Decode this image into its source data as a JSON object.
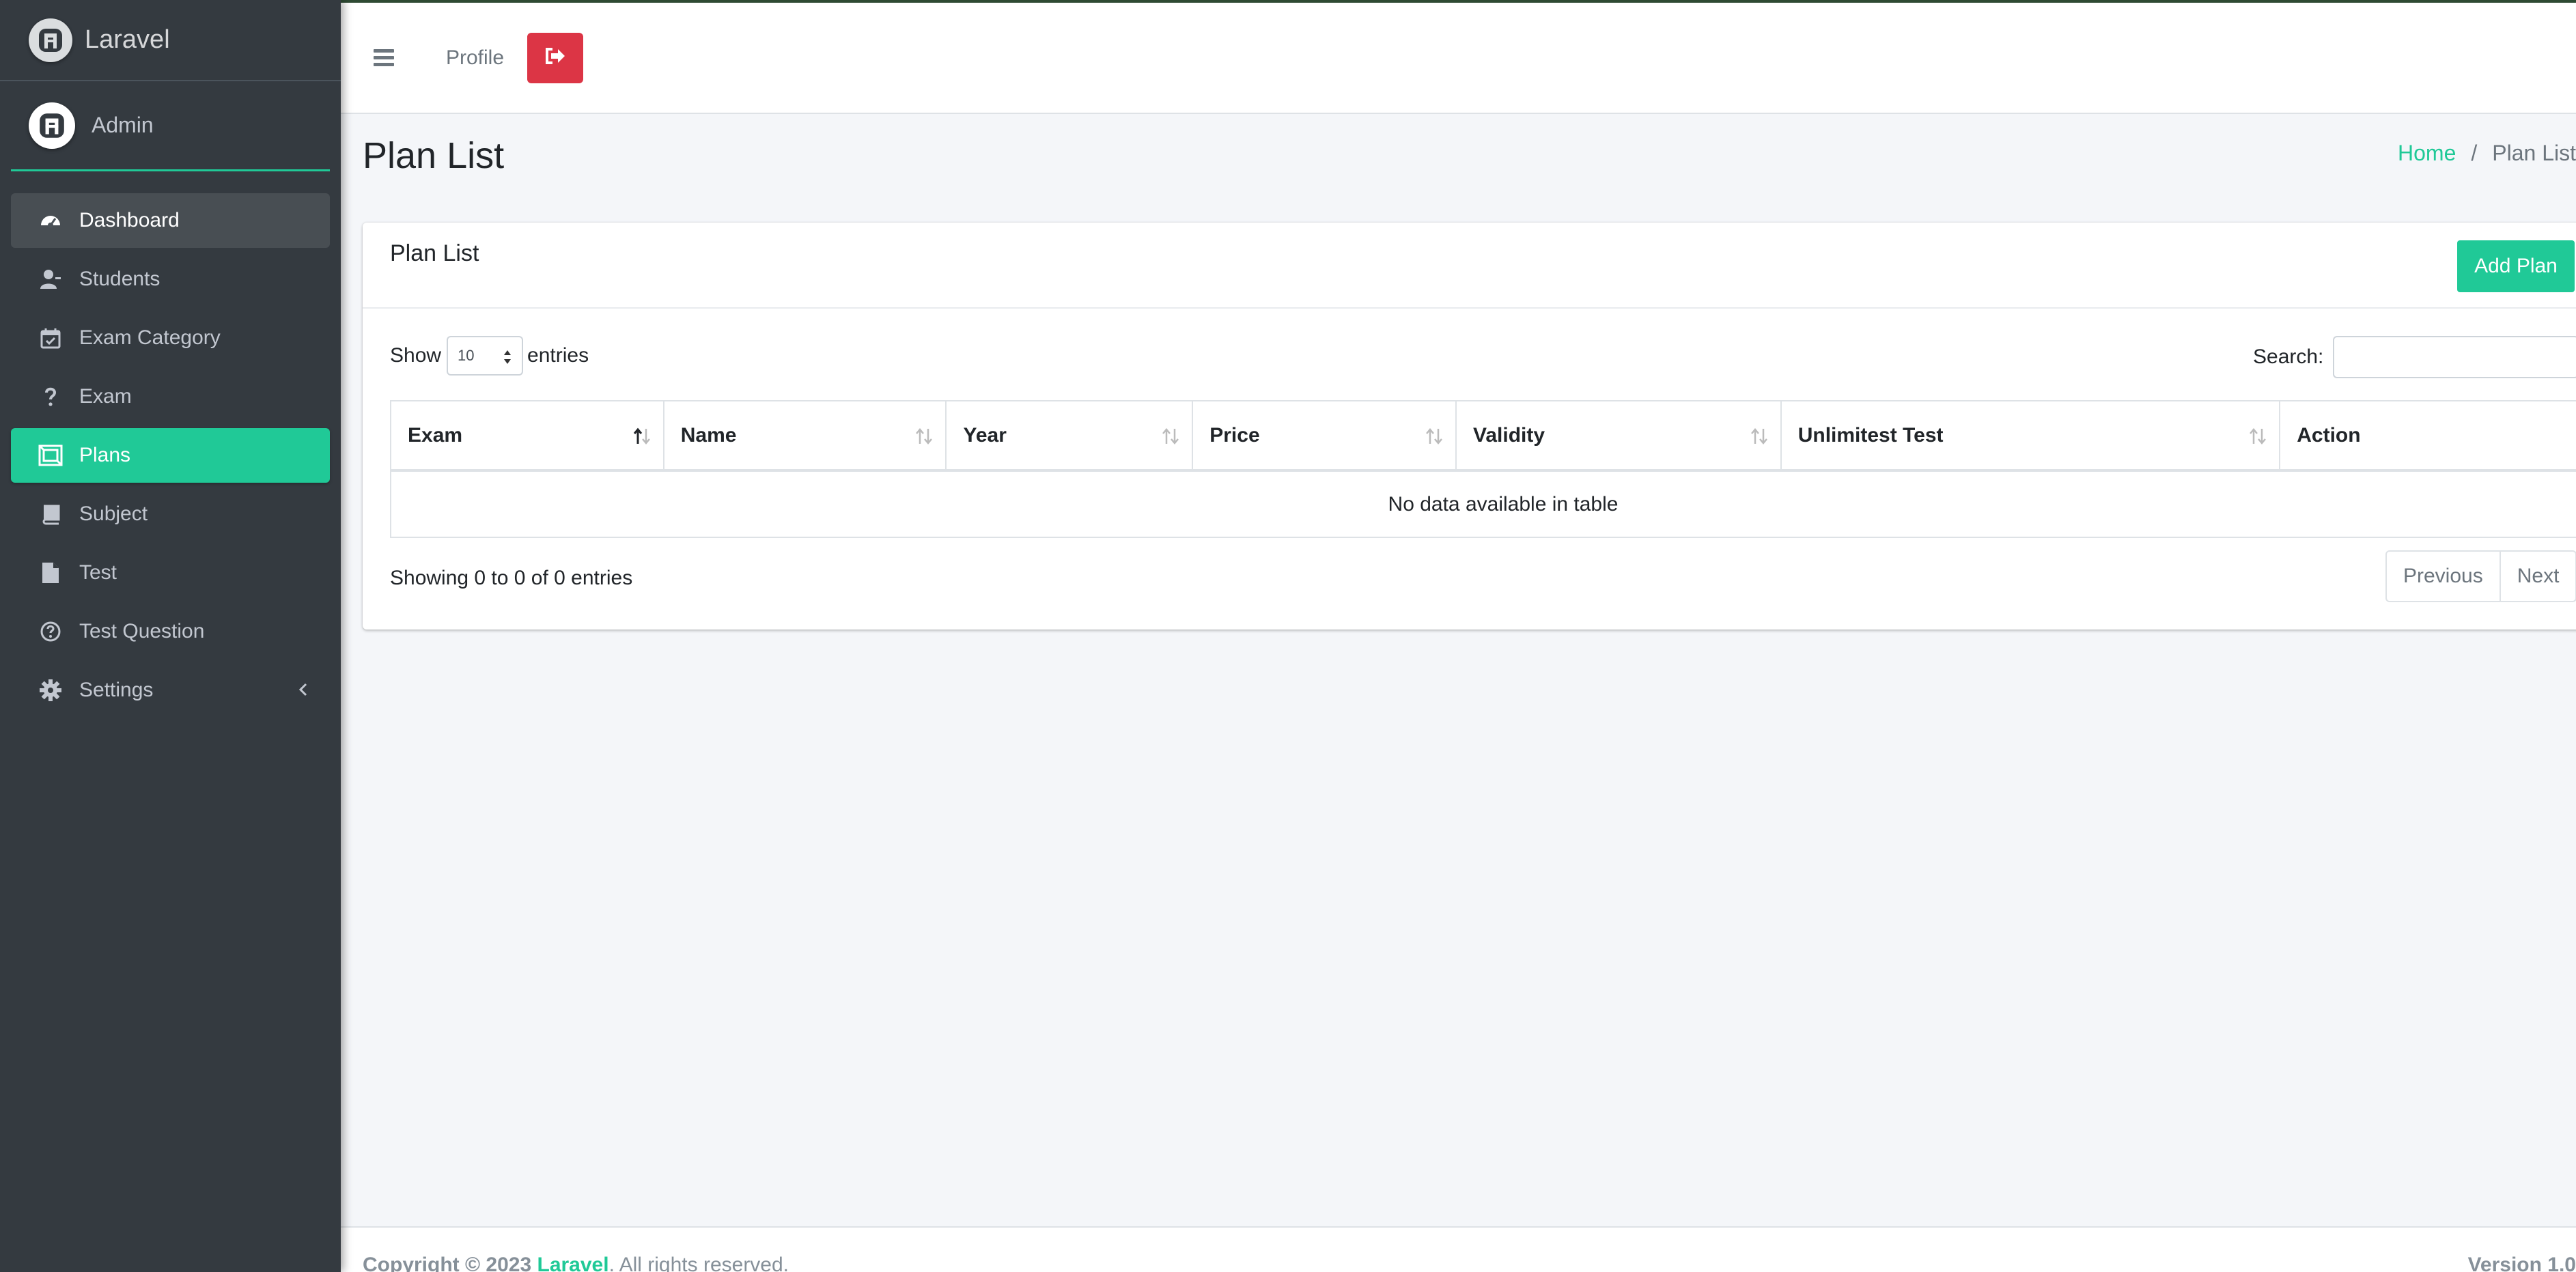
{
  "brand": {
    "name": "Laravel"
  },
  "user": {
    "name": "Admin"
  },
  "sidebar": {
    "items": [
      {
        "label": "Dashboard",
        "icon": "tachometer-icon",
        "state": "hover"
      },
      {
        "label": "Students",
        "icon": "user-icon"
      },
      {
        "label": "Exam Category",
        "icon": "calendar-check-icon"
      },
      {
        "label": "Exam",
        "icon": "question-icon"
      },
      {
        "label": "Plans",
        "icon": "plans-icon",
        "state": "active"
      },
      {
        "label": "Subject",
        "icon": "book-icon"
      },
      {
        "label": "Test",
        "icon": "file-icon"
      },
      {
        "label": "Test Question",
        "icon": "question-circle-icon"
      },
      {
        "label": "Settings",
        "icon": "gear-icon",
        "has_submenu": true
      }
    ]
  },
  "topbar": {
    "profile_label": "Profile",
    "logout_icon": "sign-out-icon"
  },
  "page": {
    "title": "Plan List",
    "breadcrumb": {
      "home": "Home",
      "separator": "/",
      "current": "Plan List"
    }
  },
  "card": {
    "title": "Plan List",
    "add_button": "Add Plan",
    "show_label": "Show",
    "entries_label": "entries",
    "page_length": "10",
    "search_label": "Search:",
    "search_value": "",
    "columns": [
      "Exam",
      "Name",
      "Year",
      "Price",
      "Validity",
      "Unlimitest Test",
      "Action"
    ],
    "empty_message": "No data available in table",
    "info": "Showing 0 to 0 of 0 entries",
    "pagination": {
      "previous": "Previous",
      "next": "Next"
    }
  },
  "footer": {
    "copyright_prefix": "Copyright © 2023 ",
    "link": "Laravel",
    "suffix": ". All rights reserved.",
    "version": "Version 1.0"
  },
  "colors": {
    "accent": "#20c997",
    "danger": "#dc3545",
    "sidebar": "#343a40",
    "background": "#f4f6f9"
  }
}
